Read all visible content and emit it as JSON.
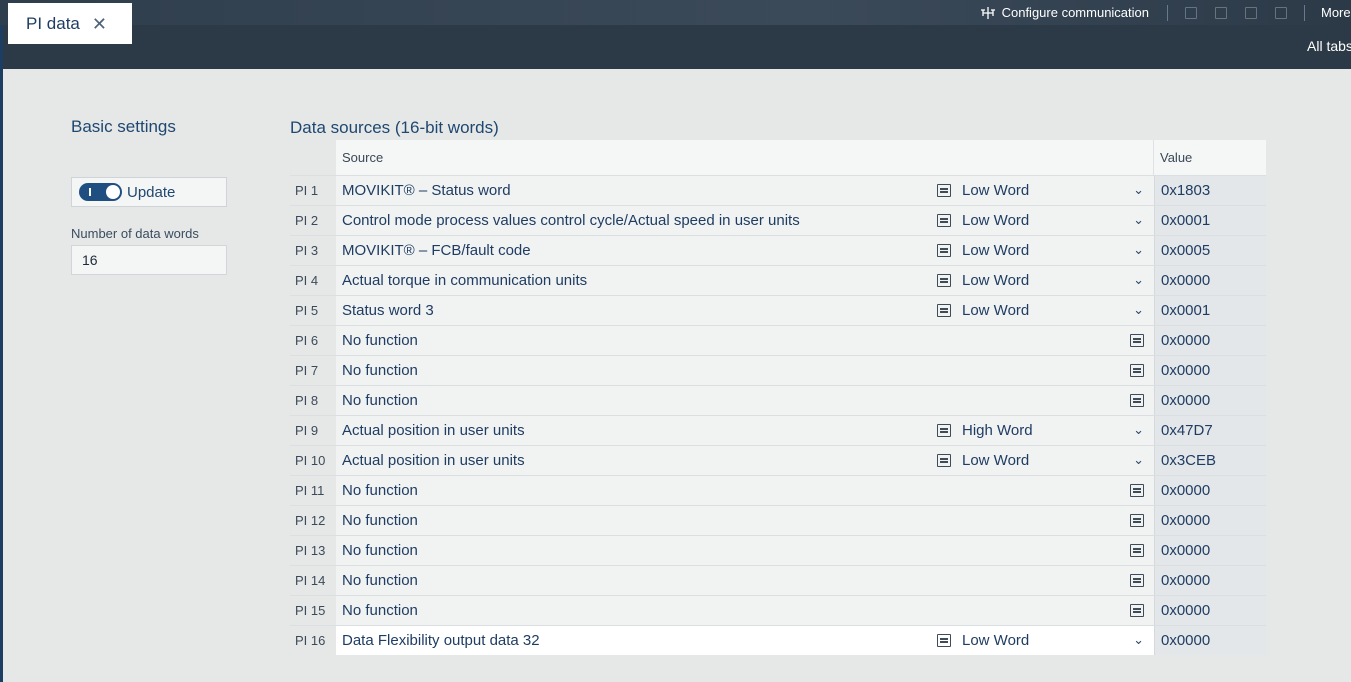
{
  "toolbar": {
    "configure_label": "Configure communication",
    "more_label": "More"
  },
  "tab": {
    "label": "PI data",
    "close_glyph": "✕"
  },
  "all_tabs_label": "All tabs",
  "basic": {
    "title": "Basic settings",
    "update_label": "Update",
    "update_on": true,
    "num_words_label": "Number of data words",
    "num_words_value": "16"
  },
  "data_sources": {
    "title": "Data sources (16-bit words)",
    "col_source": "Source",
    "col_value": "Value",
    "rows": [
      {
        "pi": "PI 1",
        "source": "MOVIKIT® – Status word",
        "word": "Low Word",
        "value": "0x1803"
      },
      {
        "pi": "PI 2",
        "source": "Control mode process values control cycle/Actual speed in user units",
        "word": "Low Word",
        "value": "0x0001"
      },
      {
        "pi": "PI 3",
        "source": "MOVIKIT® – FCB/fault code",
        "word": "Low Word",
        "value": "0x0005"
      },
      {
        "pi": "PI 4",
        "source": "Actual torque in communication units",
        "word": "Low Word",
        "value": "0x0000"
      },
      {
        "pi": "PI 5",
        "source": "Status word 3",
        "word": "Low Word",
        "value": "0x0001"
      },
      {
        "pi": "PI 6",
        "source": "No function",
        "word": "",
        "value": "0x0000"
      },
      {
        "pi": "PI 7",
        "source": "No function",
        "word": "",
        "value": "0x0000"
      },
      {
        "pi": "PI 8",
        "source": "No function",
        "word": "",
        "value": "0x0000"
      },
      {
        "pi": "PI 9",
        "source": "Actual position in user units",
        "word": "High Word",
        "value": "0x47D7"
      },
      {
        "pi": "PI 10",
        "source": "Actual position in user units",
        "word": "Low Word",
        "value": "0x3CEB"
      },
      {
        "pi": "PI 11",
        "source": "No function",
        "word": "",
        "value": "0x0000"
      },
      {
        "pi": "PI 12",
        "source": "No function",
        "word": "",
        "value": "0x0000"
      },
      {
        "pi": "PI 13",
        "source": "No function",
        "word": "",
        "value": "0x0000"
      },
      {
        "pi": "PI 14",
        "source": "No function",
        "word": "",
        "value": "0x0000"
      },
      {
        "pi": "PI 15",
        "source": "No function",
        "word": "",
        "value": "0x0000"
      },
      {
        "pi": "PI 16",
        "source": "Data Flexibility output data 32",
        "word": "Low Word",
        "value": "0x0000"
      }
    ]
  }
}
